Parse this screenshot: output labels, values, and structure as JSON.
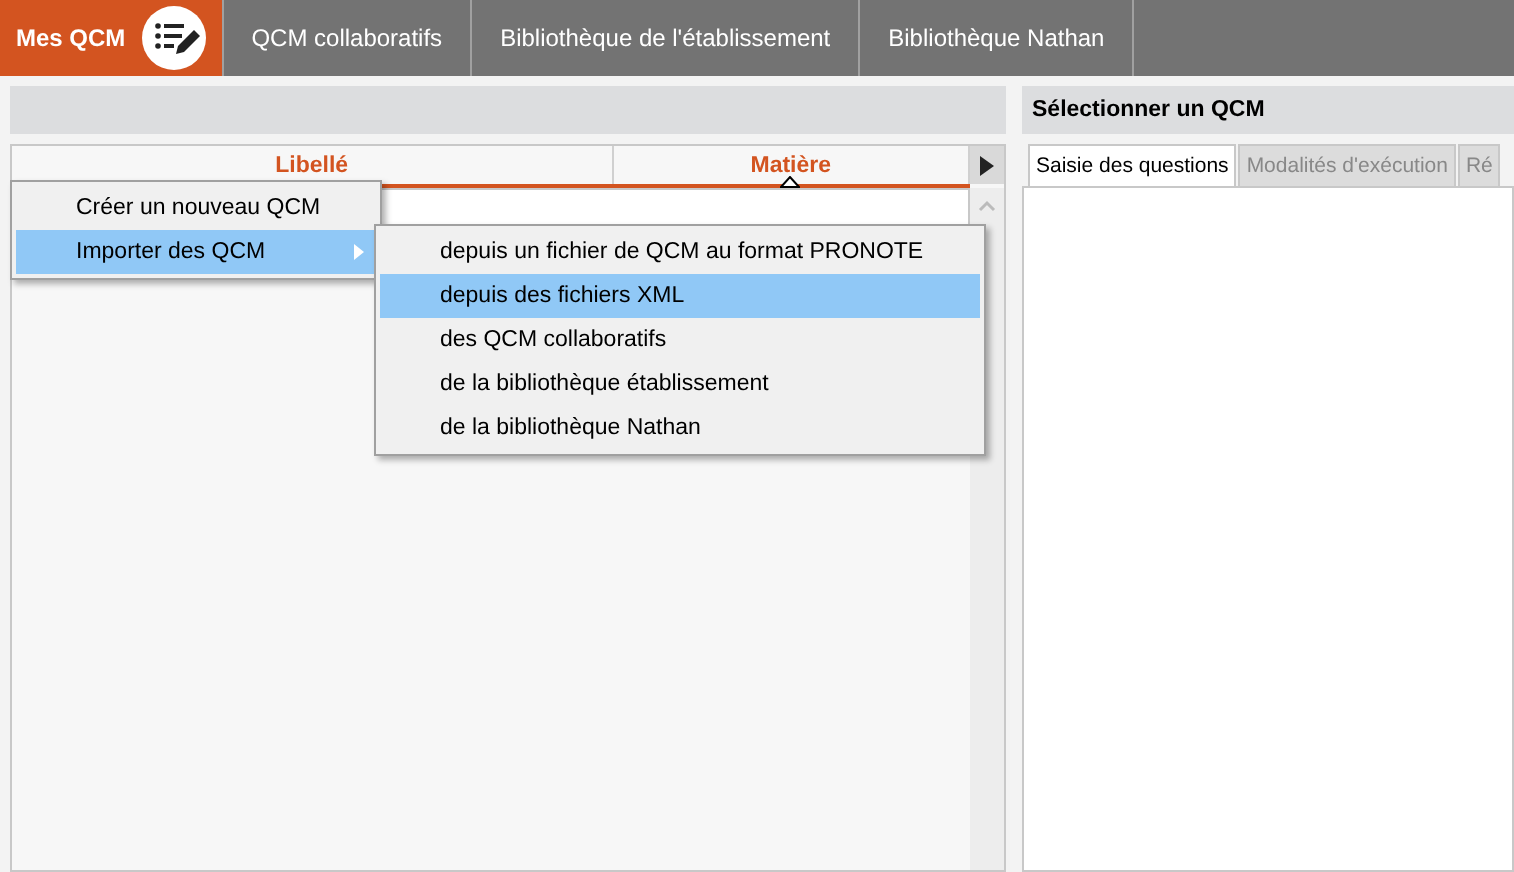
{
  "top_tabs": [
    {
      "label": "Mes QCM",
      "selected": true
    },
    {
      "label": "QCM collaboratifs",
      "selected": false
    },
    {
      "label": "Bibliothèque de l'établissement",
      "selected": false
    },
    {
      "label": "Bibliothèque Nathan",
      "selected": false
    }
  ],
  "list": {
    "columns": [
      {
        "label": "Libellé",
        "sorted": false
      },
      {
        "label": "Matière",
        "sorted": true
      }
    ]
  },
  "detail": {
    "title": "Sélectionner un QCM",
    "tabs": [
      {
        "label": "Saisie des questions",
        "selected": true
      },
      {
        "label": "Modalités d'exécution",
        "selected": false
      },
      {
        "label": "Ré",
        "selected": false
      }
    ]
  },
  "menu": {
    "items": [
      {
        "label": "Créer un nouveau QCM",
        "selected": false
      },
      {
        "label": "Importer des QCM",
        "selected": true,
        "children": [
          {
            "label": "depuis un fichier de QCM au format PRONOTE",
            "selected": false
          },
          {
            "label": "depuis des fichiers XML",
            "selected": true
          },
          {
            "label": "des QCM collaboratifs",
            "selected": false
          },
          {
            "label": "de la bibliothèque établissement",
            "selected": false
          },
          {
            "label": "de la bibliothèque Nathan",
            "selected": false
          }
        ]
      }
    ]
  }
}
